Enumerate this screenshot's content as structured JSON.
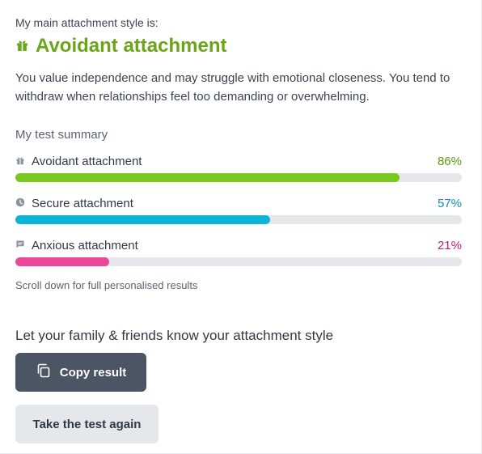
{
  "header": {
    "eyebrow": "My main attachment style is:",
    "title": "Avoidant attachment",
    "title_icon": "gift-icon",
    "title_color": "#6aa51a",
    "description": "You value independence and may struggle with emotional closeness. You tend to withdraw when relationships feel too demanding or overwhelming."
  },
  "summary": {
    "label": "My test summary",
    "items": [
      {
        "name": "Avoidant attachment",
        "percent_label": "86%",
        "value": 86,
        "icon": "gift-icon",
        "color": "#7ac81e",
        "text_color": "#5a9a12"
      },
      {
        "name": "Secure attachment",
        "percent_label": "57%",
        "value": 57,
        "icon": "clock-icon",
        "color": "#0bb3d4",
        "text_color": "#1b8fae"
      },
      {
        "name": "Anxious attachment",
        "percent_label": "21%",
        "value": 21,
        "icon": "chat-icon",
        "color": "#ec4899",
        "text_color": "#c61e6b"
      }
    ]
  },
  "hint": "Scroll down for full personalised results",
  "share": {
    "heading": "Let your family & friends know your attachment style",
    "copy_label": "Copy result",
    "copy_icon": "copy-icon",
    "retake_label": "Take the test again"
  }
}
